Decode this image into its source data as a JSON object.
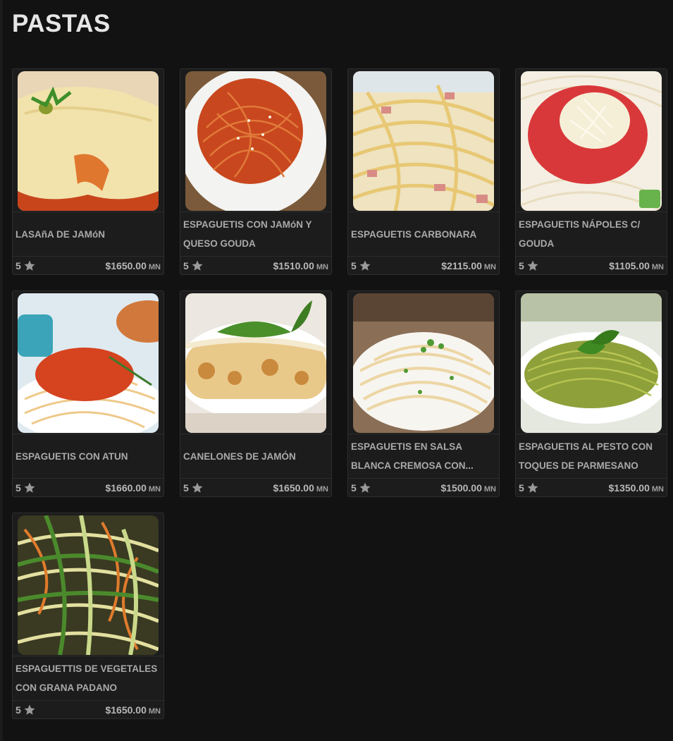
{
  "section": {
    "title": "PASTAS"
  },
  "colors": {
    "background": "#121212",
    "card": "#1c1c1c",
    "text": "#a9a9a9"
  },
  "items": [
    {
      "name": "LASAñA DE JAMóN",
      "rating": "5",
      "price": "$1650.00",
      "currency": "MN",
      "image": "lasagna-photo"
    },
    {
      "name": "ESPAGUETIS CON JAMóN Y QUESO GOUDA",
      "rating": "5",
      "price": "$1510.00",
      "currency": "MN",
      "image": "spaghetti-ham-photo"
    },
    {
      "name": "ESPAGUETIS CARBONARA",
      "rating": "5",
      "price": "$2115.00",
      "currency": "MN",
      "image": "carbonara-photo"
    },
    {
      "name": "ESPAGUETIS NÁPOLES C/ GOUDA",
      "rating": "5",
      "price": "$1105.00",
      "currency": "MN",
      "image": "napoles-photo"
    },
    {
      "name": "ESPAGUETIS CON ATUN",
      "rating": "5",
      "price": "$1660.00",
      "currency": "MN",
      "image": "tuna-spaghetti-photo"
    },
    {
      "name": "CANELONES DE JAMÓN",
      "rating": "5",
      "price": "$1650.00",
      "currency": "MN",
      "image": "cannelloni-photo"
    },
    {
      "name": "ESPAGUETIS EN SALSA BLANCA CREMOSA CON...",
      "rating": "5",
      "price": "$1500.00",
      "currency": "MN",
      "image": "cream-sauce-photo"
    },
    {
      "name": "ESPAGUETIS AL PESTO CON TOQUES DE PARMESANO",
      "rating": "5",
      "price": "$1350.00",
      "currency": "MN",
      "image": "pesto-photo"
    },
    {
      "name": "ESPAGUETTIS DE VEGETALES CON GRANA PADANO",
      "rating": "5",
      "price": "$1650.00",
      "currency": "MN",
      "image": "vegetable-spaghetti-photo"
    }
  ]
}
